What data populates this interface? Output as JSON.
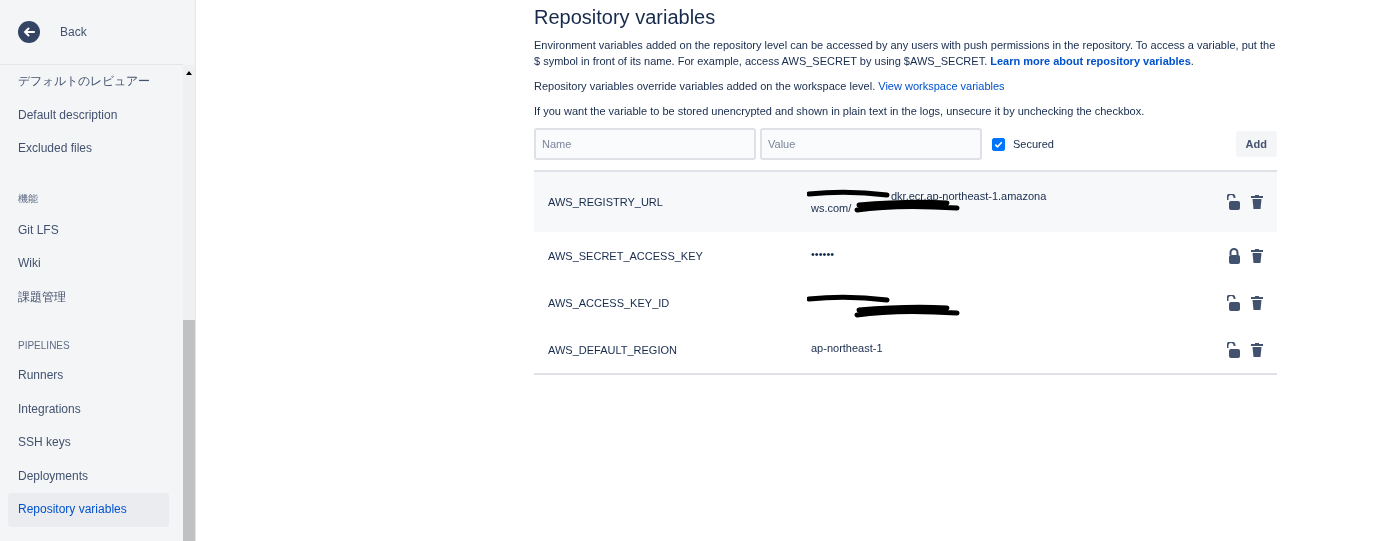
{
  "sidebar": {
    "back": "Back",
    "groups": [
      {
        "items": [
          {
            "label": "デフォルトのレビュアー",
            "selected": false
          },
          {
            "label": "Default description",
            "selected": false
          },
          {
            "label": "Excluded files",
            "selected": false
          }
        ]
      },
      {
        "heading": "機能",
        "items": [
          {
            "label": "Git LFS",
            "selected": false
          },
          {
            "label": "Wiki",
            "selected": false
          },
          {
            "label": "課題管理",
            "selected": false
          }
        ]
      },
      {
        "heading": "PIPELINES",
        "items": [
          {
            "label": "Runners",
            "selected": false
          },
          {
            "label": "Integrations",
            "selected": false
          },
          {
            "label": "SSH keys",
            "selected": false
          },
          {
            "label": "Deployments",
            "selected": false
          },
          {
            "label": "Repository variables",
            "selected": true
          }
        ]
      }
    ]
  },
  "title": "Repository variables",
  "intro": "Environment variables added on the repository level can be accessed by any users with push permissions in the repository. To access a variable, put the $ symbol in front of its name. For example, access AWS_SECRET by using $AWS_SECRET.",
  "intro_link": "Learn more about repository variables",
  "intro_tail": ".",
  "override": "Repository variables override variables added on the workspace level.",
  "override_link": "View workspace variables",
  "unsecure_note": "If you want the variable to be stored unencrypted and shown in plain text in the logs, unsecure it by unchecking the checkbox.",
  "form": {
    "name_placeholder": "Name",
    "value_placeholder": "Value",
    "secured_label": "Secured",
    "secured": true,
    "add": "Add"
  },
  "variables": [
    {
      "name": "AWS_REGISTRY_URL",
      "value_lines": [
        "dkr.ecr.ap-northeast-1.amazona",
        "ws.com/"
      ],
      "redacted": true,
      "secured": false,
      "highlighted": true
    },
    {
      "name": "AWS_SECRET_ACCESS_KEY",
      "value_lines": [
        "••••••"
      ],
      "redacted": false,
      "secured": true,
      "highlighted": false
    },
    {
      "name": "AWS_ACCESS_KEY_ID",
      "redacted": true,
      "secured": false,
      "highlighted": false
    },
    {
      "name": "AWS_DEFAULT_REGION",
      "value_lines": [
        "ap-northeast-1"
      ],
      "redacted": false,
      "secured": false,
      "highlighted": false
    }
  ]
}
